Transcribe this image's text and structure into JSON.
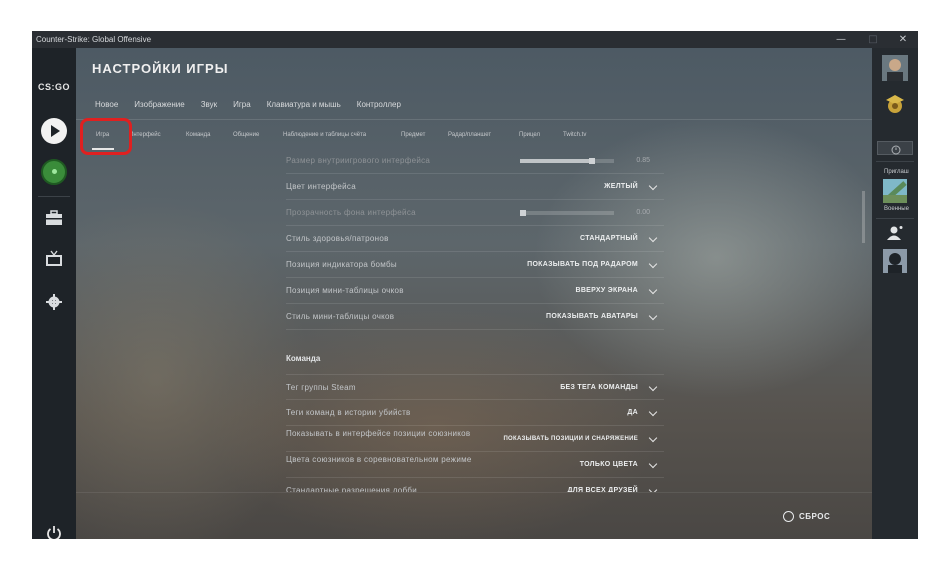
{
  "window": {
    "title": "Counter-Strike: Global Offensive",
    "controls": {
      "minimize": "—",
      "maximize": "□",
      "close": "✕"
    }
  },
  "sidebar": {
    "logo_text": "CS:GO",
    "icons": [
      "play-icon",
      "radar-icon",
      "briefcase-icon",
      "tv-icon",
      "gear-icon",
      "power-icon"
    ]
  },
  "header": {
    "title": "НАСТРОЙКИ ИГРЫ"
  },
  "tabs": [
    "Новое",
    "Изображение",
    "Звук",
    "Игра",
    "Клавиатура и мышь",
    "Контроллер"
  ],
  "subtabs": [
    "Игра",
    "Интерфейс",
    "Команда",
    "Общение",
    "Наблюдение и таблицы счёта",
    "Предмет",
    "Радар/планшет",
    "Прицел",
    "Twitch.tv"
  ],
  "settings": {
    "hud_size": {
      "label": "Размер внутриигрового интерфейса",
      "value": "0.85",
      "fraction": 0.85
    },
    "hud_color": {
      "label": "Цвет интерфейса",
      "value": "ЖЕЛТЫЙ"
    },
    "hud_bg_alpha": {
      "label": "Прозрачность фона интерфейса",
      "value": "0.00",
      "fraction": 0.0
    },
    "health_style": {
      "label": "Стиль здоровья/патронов",
      "value": "СТАНДАРТНЫЙ"
    },
    "bomb_pos": {
      "label": "Позиция индикатора бомбы",
      "value": "ПОКАЗЫВАТЬ ПОД РАДАРОМ"
    },
    "mini_pos": {
      "label": "Позиция мини-таблицы очков",
      "value": "ВВЕРХУ ЭКРАНА"
    },
    "mini_style": {
      "label": "Стиль мини-таблицы очков",
      "value": "ПОКАЗЫВАТЬ АВАТАРЫ"
    },
    "team_header": "Команда",
    "steam_tag": {
      "label": "Тег группы Steam",
      "value": "БЕЗ ТЕГА КОМАНДЫ"
    },
    "kill_tags": {
      "label": "Теги команд в истории убийств",
      "value": "ДА"
    },
    "ally_pos": {
      "label": "Показывать в интерфейсе позиции союзников",
      "value": "ПОКАЗЫВАТЬ ПОЗИЦИИ И СНАРЯЖЕНИЕ"
    },
    "ally_colors": {
      "label": "Цвета союзников в соревновательном режиме",
      "value": "ТОЛЬКО ЦВЕТА"
    },
    "lobby": {
      "label": "Стандартные разрешения лобби",
      "value": "ДЛЯ ВСЕХ ДРУЗЕЙ"
    }
  },
  "footer": {
    "reset_label": "СБРОС"
  },
  "rightbar": {
    "invite_label": "Приглаш",
    "military_label": "Военные"
  }
}
